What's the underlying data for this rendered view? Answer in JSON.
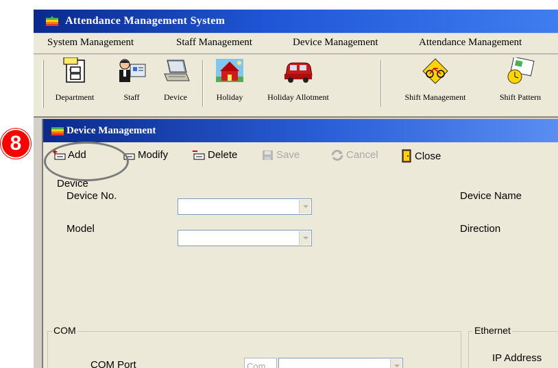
{
  "app": {
    "title": "Attendance Management System",
    "menu": [
      "System Management",
      "Staff Management",
      "Device Management",
      "Attendance Management"
    ],
    "toolbar": [
      {
        "label": "Department",
        "icon": "department-icon"
      },
      {
        "label": "Staff",
        "icon": "staff-icon"
      },
      {
        "label": "Device",
        "icon": "device-icon"
      },
      {
        "label": "Holiday",
        "icon": "holiday-icon"
      },
      {
        "label": "Holiday Allotment",
        "icon": "holiday-allotment-icon"
      },
      {
        "label": "Shift Management",
        "icon": "shift-management-icon"
      },
      {
        "label": "Shift Pattern",
        "icon": "shift-pattern-icon"
      }
    ]
  },
  "device_window": {
    "title": "Device Management",
    "actions": {
      "add": "Add",
      "modify": "Modify",
      "delete": "Delete",
      "save": "Save",
      "cancel": "Cancel",
      "close": "Close"
    },
    "section_label": "Device",
    "fields": {
      "device_no_label": "Device No.",
      "device_no_value": "",
      "model_label": "Model",
      "model_value": "",
      "device_name_label": "Device Name",
      "direction_label": "Direction"
    },
    "com_group": {
      "legend": "COM",
      "com_port_label": "COM Port",
      "com_prefix": "Com",
      "com_port_value": ""
    },
    "ethernet_group": {
      "legend": "Ethernet",
      "ip_address_label": "IP Address"
    }
  },
  "annotation": {
    "step_number": "8",
    "badge_color": "#ff0000"
  },
  "colors": {
    "titlebar_dark": "#0a2a8c",
    "titlebar_light": "#3f7df0",
    "window_bg": "#ece9d8"
  }
}
